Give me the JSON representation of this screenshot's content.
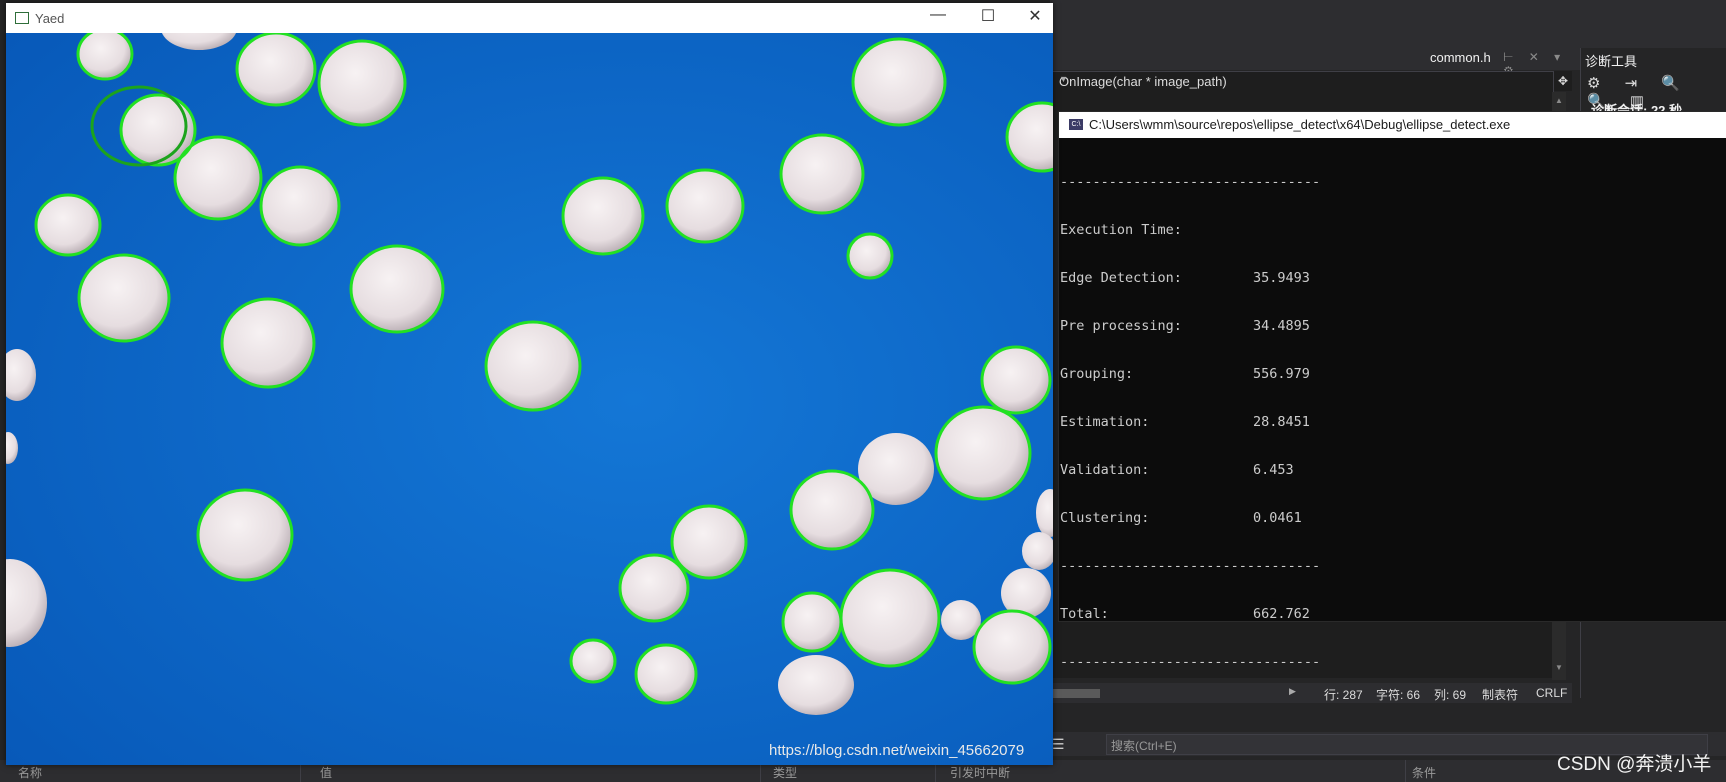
{
  "vs": {
    "doc_tab": "common.h",
    "tab_icons": "⊢ ✕ ▾ ⚙",
    "function_bar": "OnImage(char * image_path)",
    "diag_title": "诊断工具",
    "diag_tools": "⚙ ⇥ 🔍 🔍 ▥",
    "diag_session": "诊断会话: 22 秒",
    "status": {
      "line": "行: 287",
      "char": "字符: 66",
      "col": "列: 69",
      "tabs": "制表符",
      "eol": "CRLF"
    },
    "search_placeholder": "搜索(Ctrl+E)",
    "headers": {
      "name": "名称",
      "value": "值",
      "type": "类型",
      "break_when": "引发时中断",
      "condition": "条件"
    }
  },
  "console": {
    "title": "C:\\Users\\wmm\\source\\repos\\ellipse_detect\\x64\\Debug\\ellipse_detect.exe",
    "separator": "--------------------------------",
    "heading": "Execution Time:",
    "rows": [
      {
        "label": "Edge Detection:",
        "value": "35.9493"
      },
      {
        "label": "Pre processing:",
        "value": "34.4895"
      },
      {
        "label": "Grouping:",
        "value": "556.979"
      },
      {
        "label": "Estimation:",
        "value": "28.8451"
      },
      {
        "label": "Validation:",
        "value": "6.453"
      },
      {
        "label": "Clustering:",
        "value": "0.0461"
      }
    ],
    "total_label": "Total:",
    "total_value": "662.762"
  },
  "yaed": {
    "title": "Yaed",
    "min": "—",
    "max": "☐",
    "close": "✕",
    "image_watermark": "https://blog.csdn.net/weixin_45662079",
    "colors": {
      "background": "#0a66c8",
      "ellipse": "#22e122",
      "ball": "#ebe4e6"
    }
  },
  "watermark": "CSDN @奔溃小羊"
}
